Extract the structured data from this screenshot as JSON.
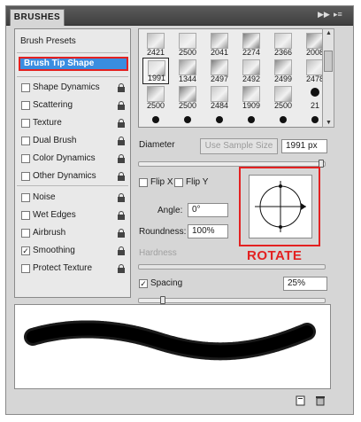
{
  "panel": {
    "tab_title": "BRUSHES",
    "menu_icons": [
      "double-arrow-icon",
      "panel-menu-icon"
    ]
  },
  "sidebar": {
    "header": "Brush Presets",
    "active": "Brush Tip Shape",
    "items": [
      {
        "label": "Shape Dynamics",
        "checked": false
      },
      {
        "label": "Scattering",
        "checked": false
      },
      {
        "label": "Texture",
        "checked": false
      },
      {
        "label": "Dual Brush",
        "checked": false
      },
      {
        "label": "Color Dynamics",
        "checked": false
      },
      {
        "label": "Other Dynamics",
        "checked": false
      },
      {
        "label": "Noise",
        "checked": false
      },
      {
        "label": "Wet Edges",
        "checked": false
      },
      {
        "label": "Airbrush",
        "checked": false
      },
      {
        "label": "Smoothing",
        "checked": true
      },
      {
        "label": "Protect Texture",
        "checked": false
      }
    ]
  },
  "brush_grid": {
    "rows": [
      [
        "2421",
        "2500",
        "2041",
        "2274",
        "2366",
        "2008"
      ],
      [
        "1991",
        "1344",
        "2497",
        "2492",
        "2499",
        "2478"
      ],
      [
        "2500",
        "2500",
        "2484",
        "1909",
        "2500",
        "21"
      ],
      [
        "",
        "",
        "",
        "",
        "",
        ""
      ]
    ],
    "selected": "1991"
  },
  "controls": {
    "diameter_label": "Diameter",
    "sample_button": "Use Sample Size",
    "diameter_value": "1991 px",
    "diameter_level": 0.99,
    "flip_x": "Flip X",
    "flip_y": "Flip Y",
    "angle_label": "Angle:",
    "angle_value": "0°",
    "roundness_label": "Roundness:",
    "roundness_value": "100%",
    "hardness_label": "Hardness",
    "spacing_label": "Spacing",
    "spacing_checked": true,
    "spacing_value": "25%",
    "spacing_level": 0.12
  },
  "annotation": {
    "rotate_label": "ROTATE",
    "highlight_color": "#e32121"
  },
  "colors": {
    "selection": "#3a8de0",
    "panel": "#d6d6d6"
  },
  "footer": {
    "icons": [
      "new-brush-icon",
      "delete-brush-icon"
    ]
  }
}
